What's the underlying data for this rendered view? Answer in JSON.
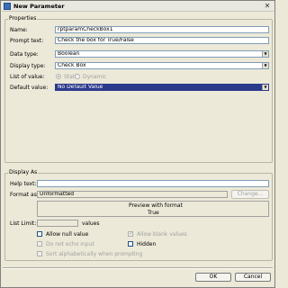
{
  "window": {
    "title": "New Parameter"
  },
  "properties": {
    "legend": "Properties",
    "name_label": "Name:",
    "name_value": "rptparamCheckBox1",
    "prompt_label": "Prompt text:",
    "prompt_value": "Check the box for True/False",
    "datatype_label": "Data type:",
    "datatype_value": "Boolean",
    "displaytype_label": "Display type:",
    "displaytype_value": "Check Box",
    "listvalue_label": "List of value:",
    "static_label": "Static",
    "dynamic_label": "Dynamic",
    "default_label": "Default value:",
    "default_value": "No Default Value"
  },
  "display_as": {
    "legend": "Display As",
    "helptext_label": "Help text:",
    "helptext_value": "",
    "format_label": "Format as:",
    "format_value": "Unformatted",
    "change_label": "Change...",
    "preview_label": "Preview with format",
    "preview_value": "True",
    "listlimit_label": "List Limit:",
    "listlimit_value": "",
    "values_label": "values",
    "allow_null_label": "Allow null value",
    "allow_blank_label": "Allow blank values",
    "no_echo_label": "Do not echo input",
    "hidden_label": "Hidden",
    "sort_label": "Sort alphabetically when prompting"
  },
  "buttons": {
    "ok": "OK",
    "cancel": "Cancel"
  },
  "colors": {
    "selection": "#2b3a8c",
    "frame": "#ece9d8"
  }
}
